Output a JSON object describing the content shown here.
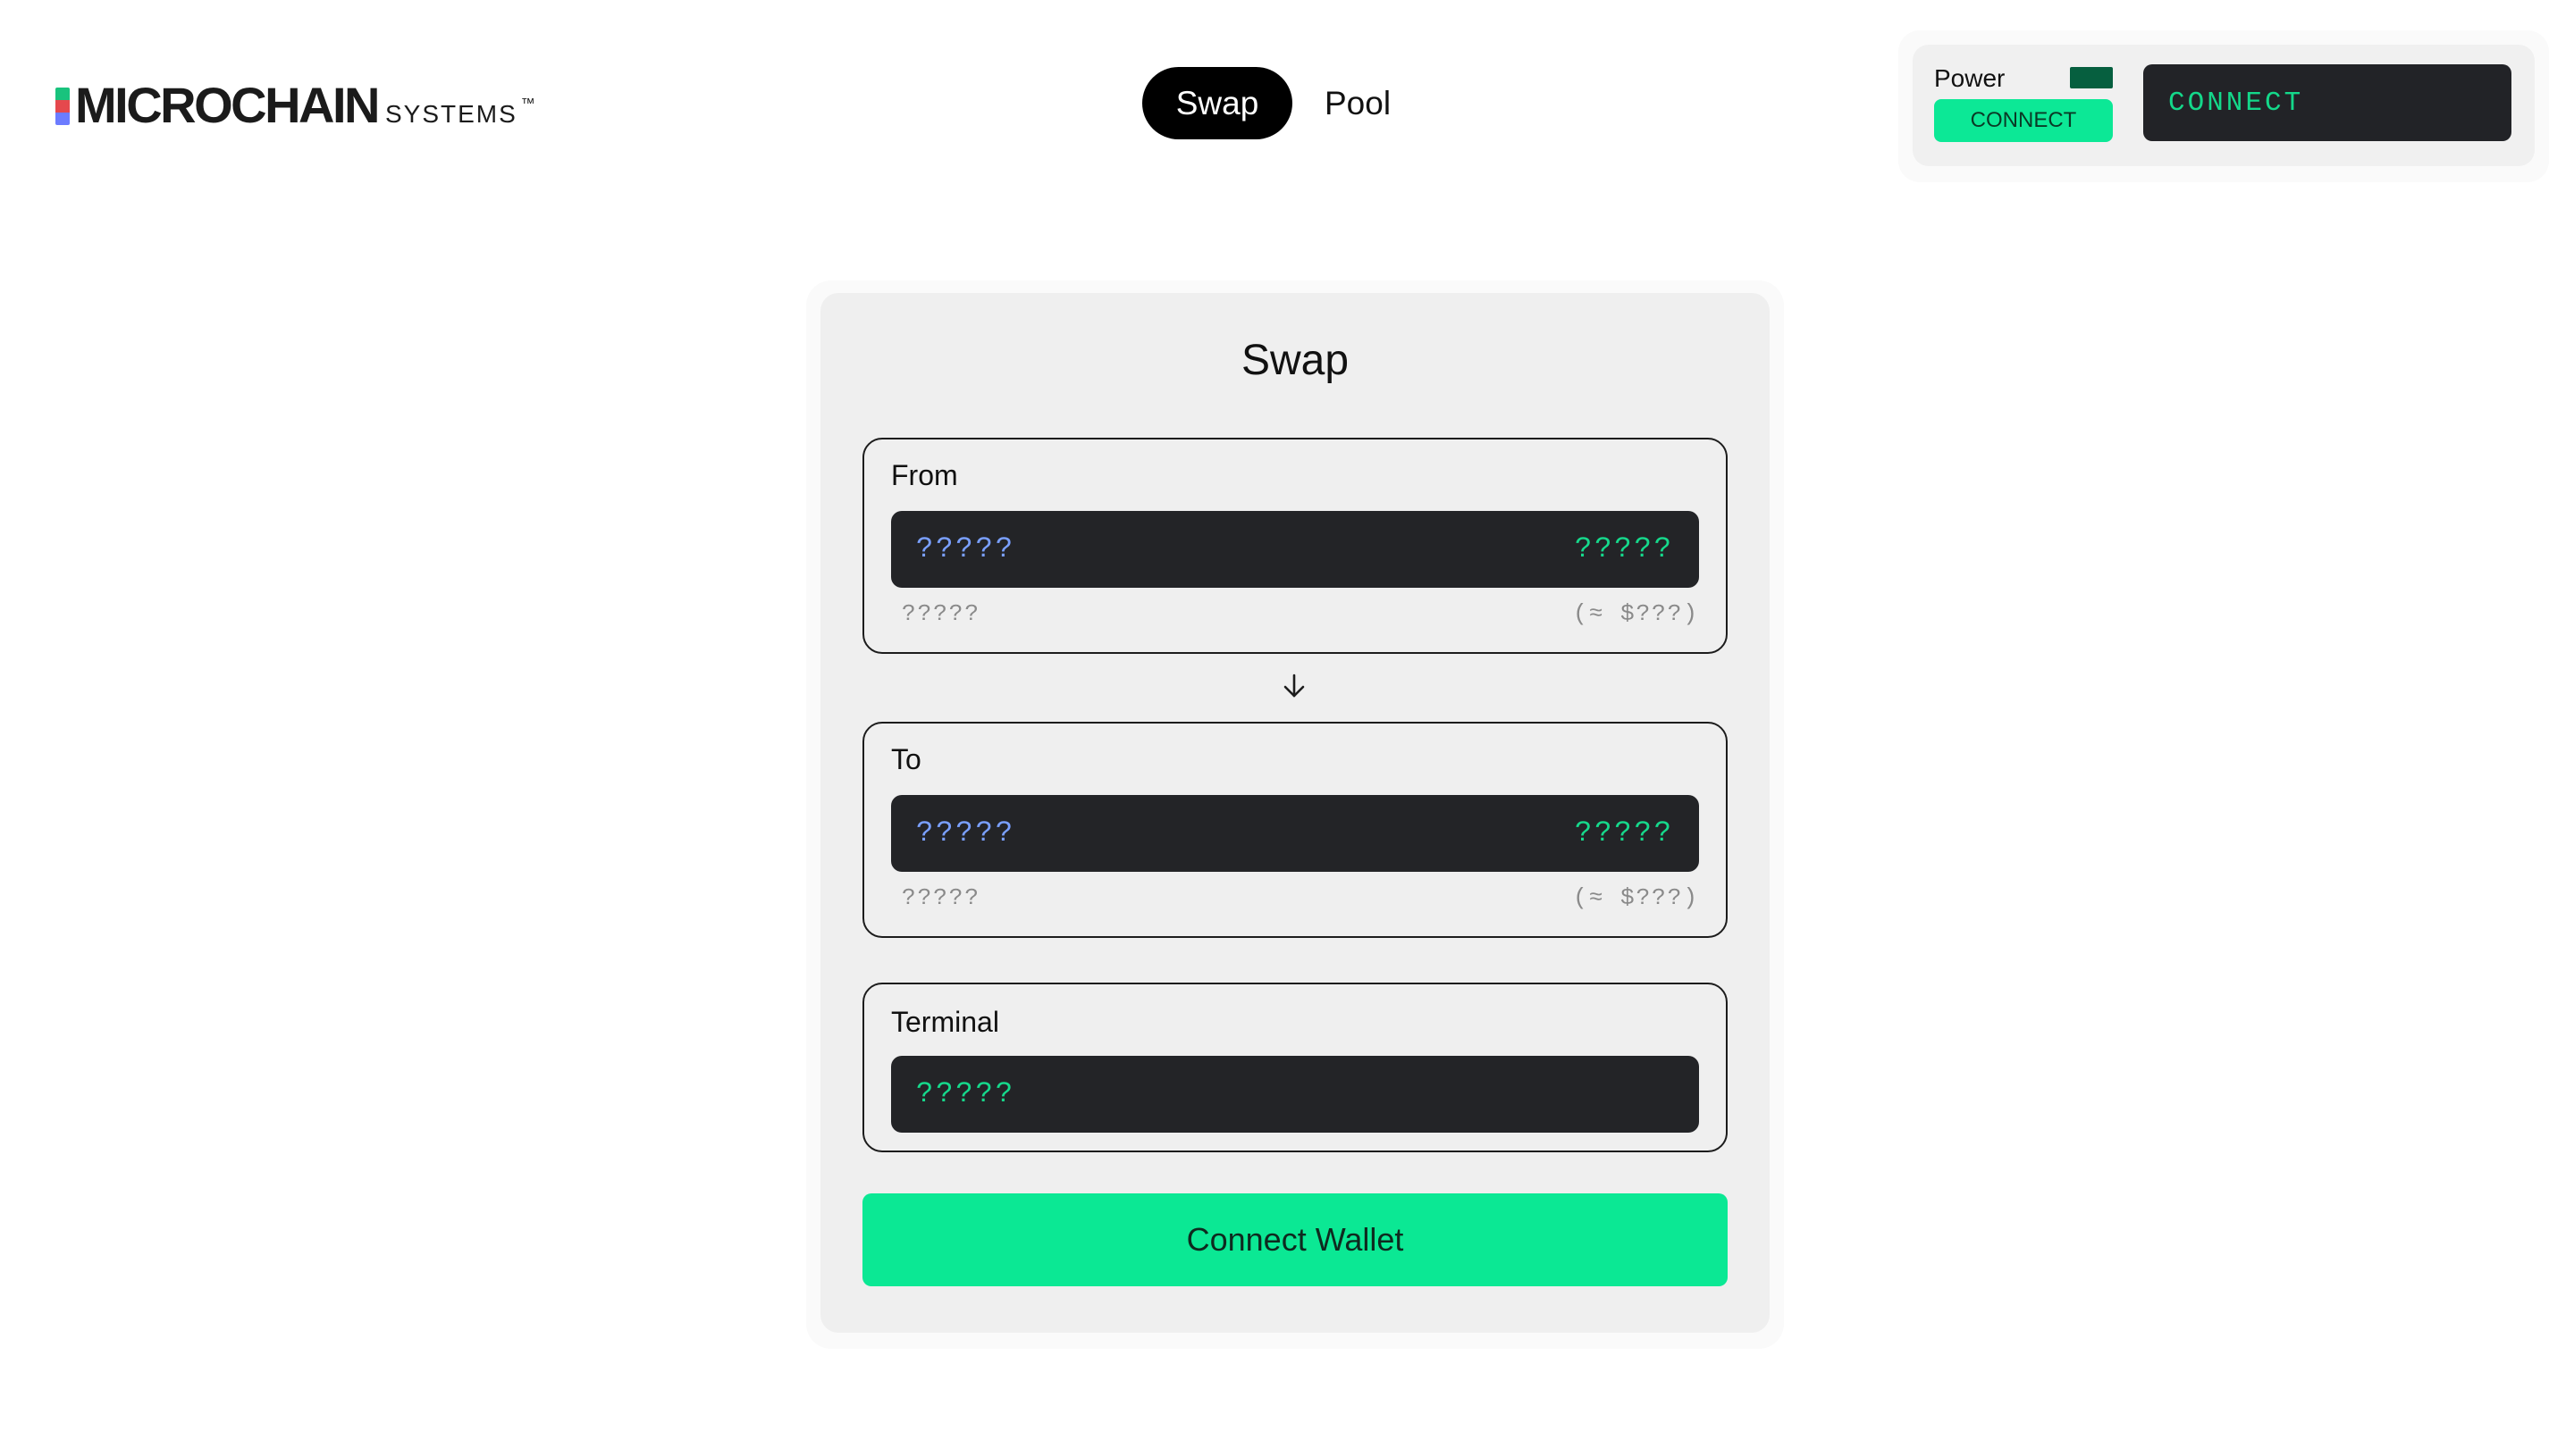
{
  "brand": {
    "name": "MICROCHAIN",
    "sub": "SYSTEMS",
    "tm": "™",
    "mark_colors": [
      "#19c37d",
      "#e5484d",
      "#6c7cff"
    ]
  },
  "nav": {
    "tabs": [
      {
        "label": "Swap",
        "active": true
      },
      {
        "label": "Pool",
        "active": false
      }
    ]
  },
  "power_widget": {
    "power_label": "Power",
    "led_color": "#065f3f",
    "small_connect_label": "CONNECT",
    "big_connect_label": "CONNECT"
  },
  "swap": {
    "title": "Swap",
    "from": {
      "label": "From",
      "token": "?????",
      "amount": "?????",
      "balance": "?????",
      "usd": "(≈ $???)"
    },
    "to": {
      "label": "To",
      "token": "?????",
      "amount": "?????",
      "balance": "?????",
      "usd": "(≈ $???)"
    },
    "terminal": {
      "label": "Terminal",
      "value": "?????"
    },
    "connect_wallet_label": "Connect Wallet"
  },
  "colors": {
    "accent": "#0be894",
    "field_bg": "#232427",
    "token_text": "#7aa0ff",
    "amount_text": "#16d98c"
  }
}
